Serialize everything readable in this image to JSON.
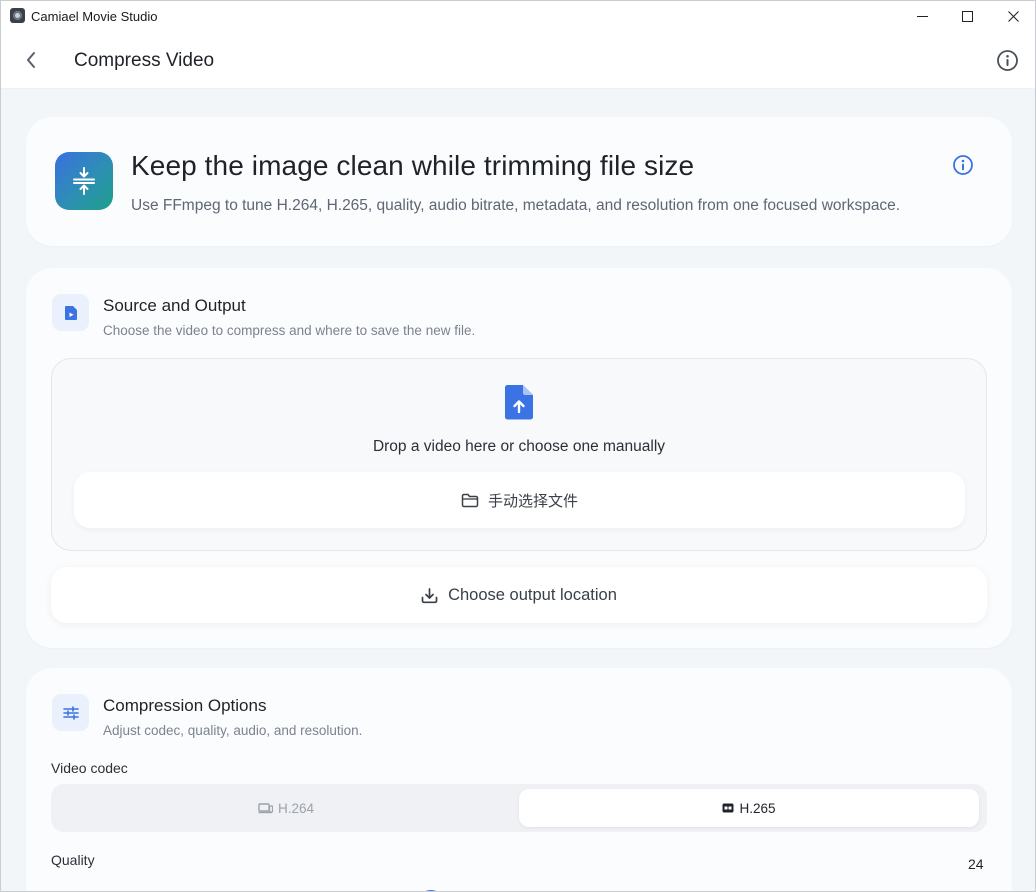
{
  "window": {
    "title": "Camiael Movie Studio",
    "controls": [
      "minimize-icon",
      "maximize-icon",
      "close-icon"
    ]
  },
  "header": {
    "title": "Compress Video",
    "back_icon": "chevron-left-icon",
    "info_icon": "info-icon"
  },
  "hero": {
    "title": "Keep the image clean while trimming file size",
    "subtitle": "Use FFmpeg to tune H.264, H.265, quality, audio bitrate, metadata, and resolution from one focused workspace.",
    "icon": "compress-icon",
    "info_icon": "info-icon"
  },
  "source": {
    "title": "Source and Output",
    "subtitle": "Choose the video to compress and where to save the new file.",
    "icon": "video-file-icon",
    "drop_text": "Drop a video here or choose one manually",
    "drop_icon": "file-upload-icon",
    "choose_file_label": "手动选择文件",
    "choose_file_icon": "folder-icon",
    "output_label": "Choose output location",
    "output_icon": "download-icon"
  },
  "options": {
    "title": "Compression Options",
    "subtitle": "Adjust codec, quality, audio, and resolution.",
    "icon": "sliders-icon",
    "codec_label": "Video codec",
    "codecs": [
      {
        "label": "H.264",
        "icon": "monitor-icon",
        "selected": false
      },
      {
        "label": "H.265",
        "icon": "hd-badge-icon",
        "selected": true
      }
    ],
    "quality_label": "Quality",
    "quality_value": "24"
  },
  "colors": {
    "accent": "#3b73e5",
    "background": "#f3f6f9",
    "card": "#fbfcfd"
  }
}
